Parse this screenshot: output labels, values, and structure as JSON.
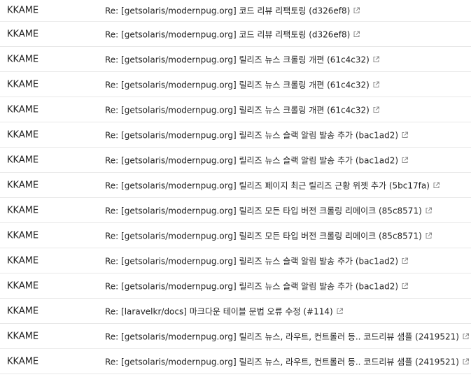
{
  "rows": [
    {
      "author": "KKAME",
      "subject": "Re: [getsolaris/modernpug.org] 코드 리뷰 리팩토링 (d326ef8)",
      "icon": "external-link-icon"
    },
    {
      "author": "KKAME",
      "subject": "Re: [getsolaris/modernpug.org] 코드 리뷰 리팩토링 (d326ef8)",
      "icon": "external-link-icon"
    },
    {
      "author": "KKAME",
      "subject": "Re: [getsolaris/modernpug.org] 릴리즈 뉴스 크롤링 개편 (61c4c32)",
      "icon": "external-link-icon"
    },
    {
      "author": "KKAME",
      "subject": "Re: [getsolaris/modernpug.org] 릴리즈 뉴스 크롤링 개편 (61c4c32)",
      "icon": "external-link-icon"
    },
    {
      "author": "KKAME",
      "subject": "Re: [getsolaris/modernpug.org] 릴리즈 뉴스 크롤링 개편 (61c4c32)",
      "icon": "external-link-icon"
    },
    {
      "author": "KKAME",
      "subject": "Re: [getsolaris/modernpug.org] 릴리즈 뉴스 슬랙 알림 발송 추가 (bac1ad2)",
      "icon": "external-link-icon"
    },
    {
      "author": "KKAME",
      "subject": "Re: [getsolaris/modernpug.org] 릴리즈 뉴스 슬랙 알림 발송 추가 (bac1ad2)",
      "icon": "external-link-icon"
    },
    {
      "author": "KKAME",
      "subject": "Re: [getsolaris/modernpug.org] 릴리즈 페이지 최근 릴리즈 근황 위젯 추가 (5bc17fa)",
      "icon": "external-link-icon"
    },
    {
      "author": "KKAME",
      "subject": "Re: [getsolaris/modernpug.org] 릴리즈 모든 타입 버전 크롤링 리메이크 (85c8571)",
      "icon": "external-link-icon"
    },
    {
      "author": "KKAME",
      "subject": "Re: [getsolaris/modernpug.org] 릴리즈 모든 타입 버전 크롤링 리메이크 (85c8571)",
      "icon": "external-link-icon"
    },
    {
      "author": "KKAME",
      "subject": "Re: [getsolaris/modernpug.org] 릴리즈 뉴스 슬랙 알림 발송 추가 (bac1ad2)",
      "icon": "external-link-icon"
    },
    {
      "author": "KKAME",
      "subject": "Re: [getsolaris/modernpug.org] 릴리즈 뉴스 슬랙 알림 발송 추가 (bac1ad2)",
      "icon": "external-link-icon"
    },
    {
      "author": "KKAME",
      "subject": "Re: [laravelkr/docs] 마크다운 테이블 문법 오류 수정 (#114)",
      "icon": "external-link-icon"
    },
    {
      "author": "KKAME",
      "subject": "Re: [getsolaris/modernpug.org] 릴리즈 뉴스, 라우트, 컨트롤러 등.. 코드리뷰 샘플 (2419521)",
      "icon": "external-link-icon"
    },
    {
      "author": "KKAME",
      "subject": "Re: [getsolaris/modernpug.org] 릴리즈 뉴스, 라우트, 컨트롤러 등.. 코드리뷰 샘플 (2419521)",
      "icon": "external-link-icon"
    }
  ],
  "colors": {
    "text": "#222222",
    "divider": "#e8e8e8",
    "icon": "#888888"
  }
}
